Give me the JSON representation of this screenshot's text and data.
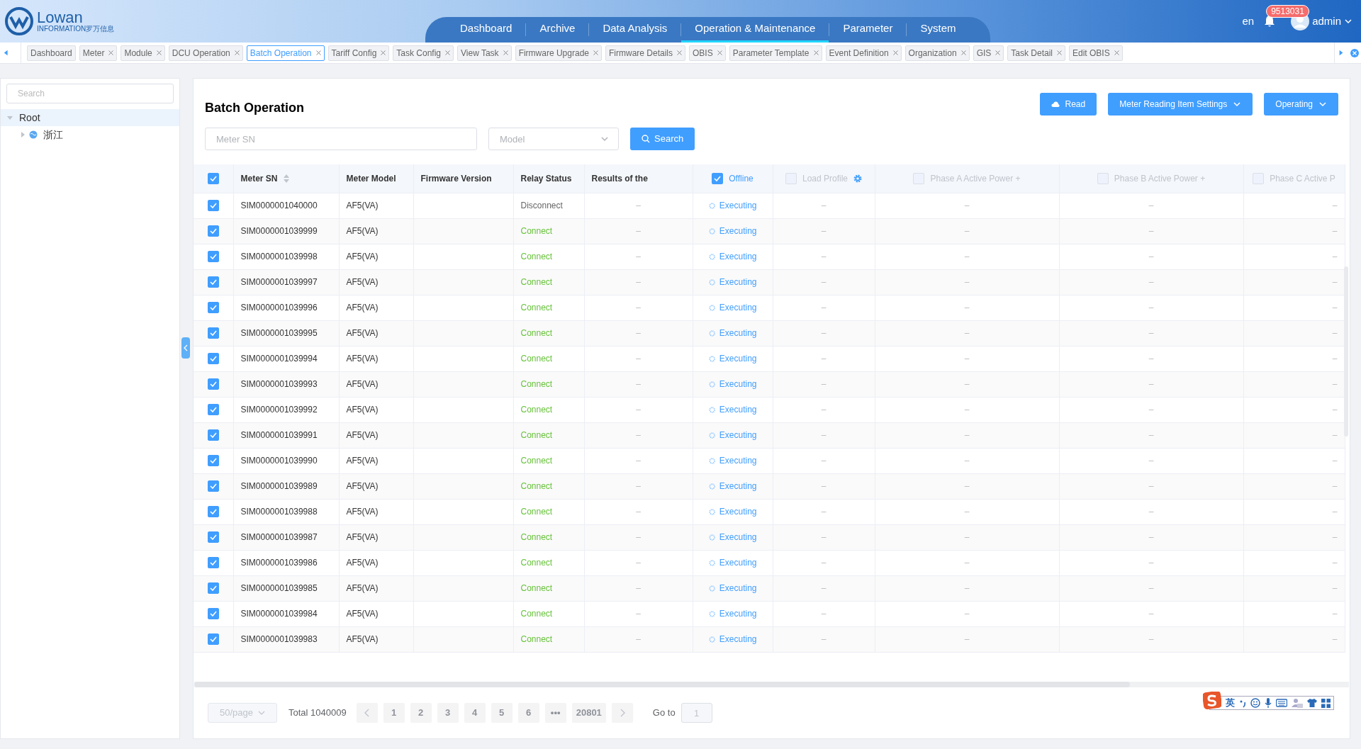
{
  "logo": {
    "name": "Lowan",
    "tagline": "INFORMATION罗万信息"
  },
  "nav": [
    {
      "label": "Dashboard",
      "selected": false
    },
    {
      "label": "Archive",
      "selected": false
    },
    {
      "label": "Data Analysis",
      "selected": false
    },
    {
      "label": "Operation & Maintenance",
      "selected": true
    },
    {
      "label": "Parameter",
      "selected": false
    },
    {
      "label": "System",
      "selected": false
    }
  ],
  "header": {
    "language": "en",
    "notification_count": "9513031",
    "user": "admin"
  },
  "open_tabs": [
    {
      "label": "Dashboard",
      "closable": false,
      "selected": false
    },
    {
      "label": "Meter",
      "closable": true,
      "selected": false
    },
    {
      "label": "Module",
      "closable": true,
      "selected": false
    },
    {
      "label": "DCU Operation",
      "closable": true,
      "selected": false
    },
    {
      "label": "Batch Operation",
      "closable": true,
      "selected": true
    },
    {
      "label": "Tariff Config",
      "closable": true,
      "selected": false
    },
    {
      "label": "Task Config",
      "closable": true,
      "selected": false
    },
    {
      "label": "View Task",
      "closable": true,
      "selected": false
    },
    {
      "label": "Firmware Upgrade",
      "closable": true,
      "selected": false
    },
    {
      "label": "Firmware Details",
      "closable": true,
      "selected": false
    },
    {
      "label": "OBIS",
      "closable": true,
      "selected": false
    },
    {
      "label": "Parameter Template",
      "closable": true,
      "selected": false
    },
    {
      "label": "Event Definition",
      "closable": true,
      "selected": false
    },
    {
      "label": "Organization",
      "closable": true,
      "selected": false
    },
    {
      "label": "GIS",
      "closable": true,
      "selected": false
    },
    {
      "label": "Task Detail",
      "closable": true,
      "selected": false
    },
    {
      "label": "Edit OBIS",
      "closable": true,
      "selected": false
    }
  ],
  "sidebar": {
    "search": {
      "placeholder": "Search"
    },
    "tree": [
      {
        "label": "Root",
        "expanded": true,
        "selected": true,
        "children": [
          {
            "label": "浙江",
            "expanded": false,
            "selected": false
          }
        ]
      }
    ]
  },
  "page": {
    "title": "Batch Operation",
    "buttons": [
      {
        "label": "Read",
        "kind": "read"
      },
      {
        "label": "Meter Reading Item Settings",
        "kind": "dropdown"
      },
      {
        "label": "Operating",
        "kind": "dropdown"
      }
    ],
    "filters": {
      "meter_sn": {
        "placeholder": "Meter SN"
      },
      "model": {
        "placeholder": "Model"
      },
      "search_button": "Search"
    }
  },
  "table": {
    "all_checked": true,
    "columns": [
      {
        "label": "Meter SN",
        "kind": "sortable"
      },
      {
        "label": "Meter Model",
        "kind": "plain"
      },
      {
        "label": "Firmware Version",
        "kind": "plain"
      },
      {
        "label": "Relay Status",
        "kind": "plain"
      },
      {
        "label": "Results of the",
        "kind": "plain"
      },
      {
        "label": "Offline",
        "kind": "check",
        "checked": true,
        "disabled": false
      },
      {
        "label": "Load Profile",
        "kind": "check",
        "checked": false,
        "disabled": true,
        "settings": true
      },
      {
        "label": "Phase A Active Power +",
        "kind": "check",
        "checked": false,
        "disabled": true
      },
      {
        "label": "Phase B Active Power +",
        "kind": "check",
        "checked": false,
        "disabled": true
      },
      {
        "label": "Phase C Active P",
        "kind": "check",
        "checked": false,
        "disabled": true
      }
    ],
    "rows": [
      {
        "checked": true,
        "meter_sn": "SIM0000001040000",
        "meter_model": "AF5(VA)",
        "relay_status": "Disconnect",
        "connected": false,
        "results": "–",
        "offline": "Executing",
        "load_profile": "–",
        "phase_a": "–",
        "phase_b": "–",
        "phase_c": "–"
      },
      {
        "checked": true,
        "meter_sn": "SIM0000001039999",
        "meter_model": "AF5(VA)",
        "relay_status": "Connect",
        "connected": true,
        "results": "–",
        "offline": "Executing",
        "load_profile": "–",
        "phase_a": "–",
        "phase_b": "–",
        "phase_c": "–"
      },
      {
        "checked": true,
        "meter_sn": "SIM0000001039998",
        "meter_model": "AF5(VA)",
        "relay_status": "Connect",
        "connected": true,
        "results": "–",
        "offline": "Executing",
        "load_profile": "–",
        "phase_a": "–",
        "phase_b": "–",
        "phase_c": "–"
      },
      {
        "checked": true,
        "meter_sn": "SIM0000001039997",
        "meter_model": "AF5(VA)",
        "relay_status": "Connect",
        "connected": true,
        "results": "–",
        "offline": "Executing",
        "load_profile": "–",
        "phase_a": "–",
        "phase_b": "–",
        "phase_c": "–"
      },
      {
        "checked": true,
        "meter_sn": "SIM0000001039996",
        "meter_model": "AF5(VA)",
        "relay_status": "Connect",
        "connected": true,
        "results": "–",
        "offline": "Executing",
        "load_profile": "–",
        "phase_a": "–",
        "phase_b": "–",
        "phase_c": "–"
      },
      {
        "checked": true,
        "meter_sn": "SIM0000001039995",
        "meter_model": "AF5(VA)",
        "relay_status": "Connect",
        "connected": true,
        "results": "–",
        "offline": "Executing",
        "load_profile": "–",
        "phase_a": "–",
        "phase_b": "–",
        "phase_c": "–"
      },
      {
        "checked": true,
        "meter_sn": "SIM0000001039994",
        "meter_model": "AF5(VA)",
        "relay_status": "Connect",
        "connected": true,
        "results": "–",
        "offline": "Executing",
        "load_profile": "–",
        "phase_a": "–",
        "phase_b": "–",
        "phase_c": "–"
      },
      {
        "checked": true,
        "meter_sn": "SIM0000001039993",
        "meter_model": "AF5(VA)",
        "relay_status": "Connect",
        "connected": true,
        "results": "–",
        "offline": "Executing",
        "load_profile": "–",
        "phase_a": "–",
        "phase_b": "–",
        "phase_c": "–"
      },
      {
        "checked": true,
        "meter_sn": "SIM0000001039992",
        "meter_model": "AF5(VA)",
        "relay_status": "Connect",
        "connected": true,
        "results": "–",
        "offline": "Executing",
        "load_profile": "–",
        "phase_a": "–",
        "phase_b": "–",
        "phase_c": "–"
      },
      {
        "checked": true,
        "meter_sn": "SIM0000001039991",
        "meter_model": "AF5(VA)",
        "relay_status": "Connect",
        "connected": true,
        "results": "–",
        "offline": "Executing",
        "load_profile": "–",
        "phase_a": "–",
        "phase_b": "–",
        "phase_c": "–"
      },
      {
        "checked": true,
        "meter_sn": "SIM0000001039990",
        "meter_model": "AF5(VA)",
        "relay_status": "Connect",
        "connected": true,
        "results": "–",
        "offline": "Executing",
        "load_profile": "–",
        "phase_a": "–",
        "phase_b": "–",
        "phase_c": "–"
      },
      {
        "checked": true,
        "meter_sn": "SIM0000001039989",
        "meter_model": "AF5(VA)",
        "relay_status": "Connect",
        "connected": true,
        "results": "–",
        "offline": "Executing",
        "load_profile": "–",
        "phase_a": "–",
        "phase_b": "–",
        "phase_c": "–"
      },
      {
        "checked": true,
        "meter_sn": "SIM0000001039988",
        "meter_model": "AF5(VA)",
        "relay_status": "Connect",
        "connected": true,
        "results": "–",
        "offline": "Executing",
        "load_profile": "–",
        "phase_a": "–",
        "phase_b": "–",
        "phase_c": "–"
      },
      {
        "checked": true,
        "meter_sn": "SIM0000001039987",
        "meter_model": "AF5(VA)",
        "relay_status": "Connect",
        "connected": true,
        "results": "–",
        "offline": "Executing",
        "load_profile": "–",
        "phase_a": "–",
        "phase_b": "–",
        "phase_c": "–"
      },
      {
        "checked": true,
        "meter_sn": "SIM0000001039986",
        "meter_model": "AF5(VA)",
        "relay_status": "Connect",
        "connected": true,
        "results": "–",
        "offline": "Executing",
        "load_profile": "–",
        "phase_a": "–",
        "phase_b": "–",
        "phase_c": "–"
      },
      {
        "checked": true,
        "meter_sn": "SIM0000001039985",
        "meter_model": "AF5(VA)",
        "relay_status": "Connect",
        "connected": true,
        "results": "–",
        "offline": "Executing",
        "load_profile": "–",
        "phase_a": "–",
        "phase_b": "–",
        "phase_c": "–"
      },
      {
        "checked": true,
        "meter_sn": "SIM0000001039984",
        "meter_model": "AF5(VA)",
        "relay_status": "Connect",
        "connected": true,
        "results": "–",
        "offline": "Executing",
        "load_profile": "–",
        "phase_a": "–",
        "phase_b": "–",
        "phase_c": "–"
      },
      {
        "checked": true,
        "meter_sn": "SIM0000001039983",
        "meter_model": "AF5(VA)",
        "relay_status": "Connect",
        "connected": true,
        "results": "–",
        "offline": "Executing",
        "load_profile": "–",
        "phase_a": "–",
        "phase_b": "–",
        "phase_c": "–"
      }
    ]
  },
  "pagination": {
    "page_size": "50/page",
    "total": "Total 1040009",
    "pages": [
      "1",
      "2",
      "3",
      "4",
      "5",
      "6"
    ],
    "ellipsis": "•••",
    "last_page": "20801",
    "goto_label": "Go to",
    "goto_value": "1"
  },
  "ime_toolbar": {
    "mode": "英"
  }
}
